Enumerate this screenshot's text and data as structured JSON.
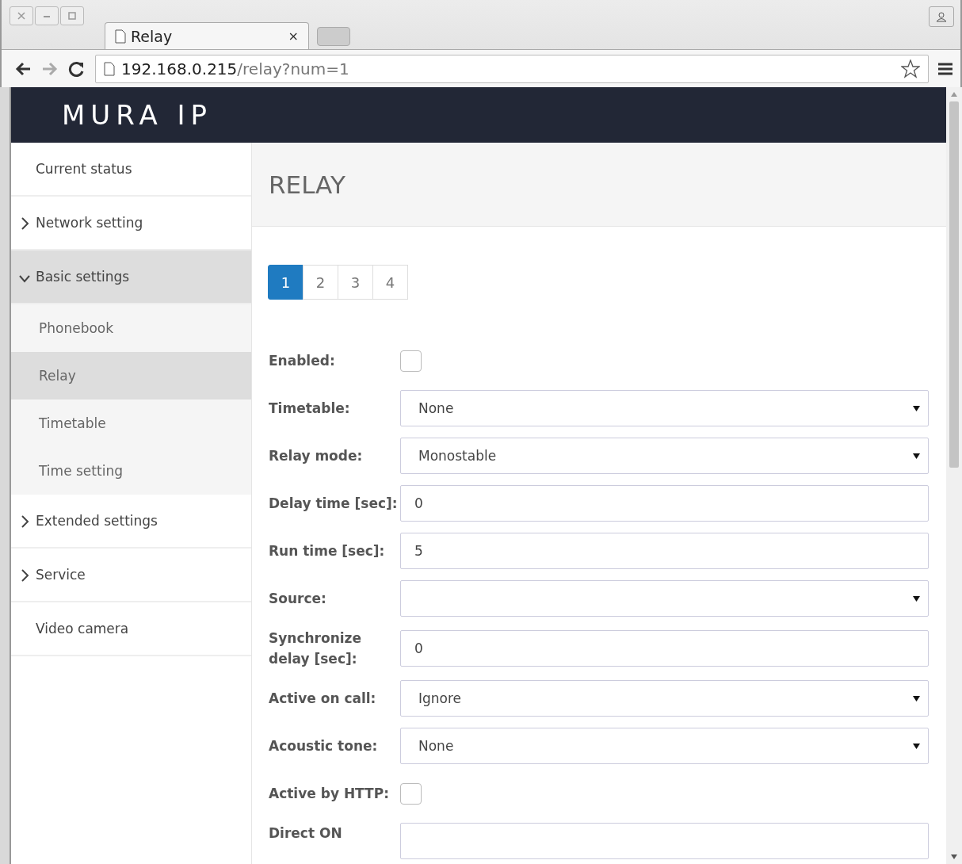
{
  "browser": {
    "tab_title": "Relay",
    "tab_close": "×",
    "url_host": "192.168.0.215",
    "url_path": "/relay?num=1"
  },
  "header": {
    "logo": "MURA IP"
  },
  "sidebar": {
    "items": [
      {
        "label": "Current status",
        "kind": "link",
        "selected": false
      },
      {
        "label": "Network setting",
        "kind": "group",
        "expanded": false,
        "selected": false
      },
      {
        "label": "Basic settings",
        "kind": "group",
        "expanded": true,
        "selected": true,
        "children": [
          {
            "label": "Phonebook",
            "selected": false
          },
          {
            "label": "Relay",
            "selected": true
          },
          {
            "label": "Timetable",
            "selected": false
          },
          {
            "label": "Time setting",
            "selected": false
          }
        ]
      },
      {
        "label": "Extended settings",
        "kind": "group",
        "expanded": false,
        "selected": false
      },
      {
        "label": "Service",
        "kind": "group",
        "expanded": false,
        "selected": false
      },
      {
        "label": "Video camera",
        "kind": "link",
        "selected": false
      }
    ]
  },
  "page_title": "RELAY",
  "relay_tabs": [
    {
      "label": "1",
      "selected": true
    },
    {
      "label": "2",
      "selected": false
    },
    {
      "label": "3",
      "selected": false
    },
    {
      "label": "4",
      "selected": false
    }
  ],
  "form": [
    {
      "label": "Enabled:",
      "kind": "checkbox",
      "checked": false
    },
    {
      "label": "Timetable:",
      "kind": "select",
      "value": "None"
    },
    {
      "label": "Relay mode:",
      "kind": "select",
      "value": "Monostable"
    },
    {
      "label": "Delay time [sec]:",
      "kind": "text",
      "value": "0"
    },
    {
      "label": "Run time [sec]:",
      "kind": "text",
      "value": "5"
    },
    {
      "label": "Source:",
      "kind": "select"
    },
    {
      "label": "Synchronize delay [sec]:",
      "kind": "text",
      "value": "0"
    },
    {
      "label": "Active on call:",
      "kind": "select",
      "value": "Ignore"
    },
    {
      "label": "Acoustic tone:",
      "kind": "select",
      "value": "None"
    },
    {
      "label": "Active by HTTP:",
      "kind": "checkbox",
      "checked": false
    },
    {
      "label": "Direct ON",
      "kind": "text"
    }
  ]
}
